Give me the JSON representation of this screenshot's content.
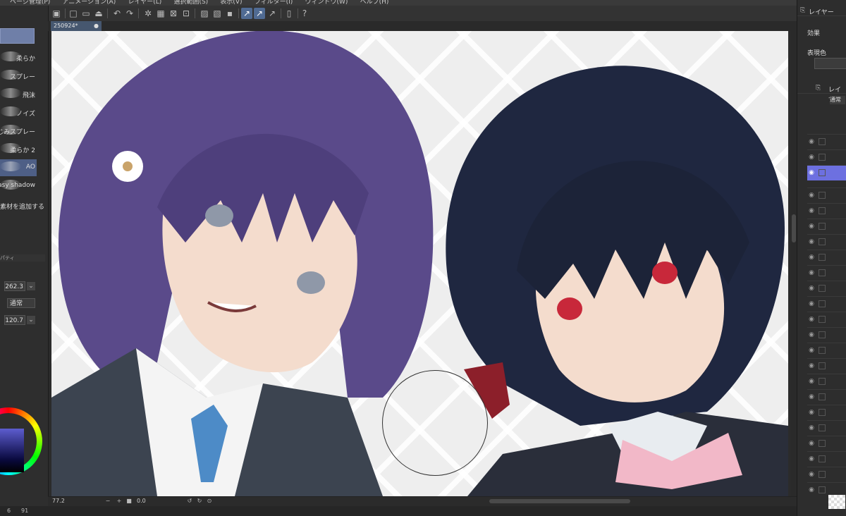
{
  "menubar": {
    "items": [
      "ページ管理(P)",
      "アニメーション(A)",
      "レイヤー(L)",
      "選択範囲(S)",
      "表示(V)",
      "フィルター(I)",
      "ウィンドウ(W)",
      "ヘルプ(H)"
    ]
  },
  "toolbar": {
    "icons": [
      "app-icon",
      "new-file-icon",
      "open-icon",
      "save-icon",
      "print-icon",
      "undo-icon",
      "redo-icon",
      "clear-icon",
      "fill-icon",
      "deselect-icon",
      "transform-icon",
      "show-selection-icon",
      "ruler-icon",
      "snap-icon",
      "snap-active-icon",
      "snap-ruler-icon",
      "device-icon",
      "help-icon"
    ]
  },
  "canvas_tab": {
    "label": "250924*",
    "close": "●"
  },
  "brushes": [
    {
      "label": "柔らか"
    },
    {
      "label": "スプレー"
    },
    {
      "label": "飛沫"
    },
    {
      "label": "ノイズ"
    },
    {
      "label": "にじみスプレー"
    },
    {
      "label": "柔らか 2"
    },
    {
      "label": "AO"
    },
    {
      "label": "easy shadow"
    }
  ],
  "brush_footer": {
    "add_material": "素材を追加する"
  },
  "properties": {
    "header": "パティ",
    "size": "262.3",
    "blend": "通常",
    "density": "120.7"
  },
  "color": {
    "foreground": "#3a3ab8"
  },
  "status": {
    "zoom": "77.2",
    "angle": "0.0"
  },
  "bottom": {
    "left_num": "6",
    "right_num": "91"
  },
  "right_panel": {
    "effect_title": "レイヤー",
    "effect_label": "効果",
    "color_label": "表現色",
    "layer_title": "レイヤー",
    "blend_mode": "通常"
  }
}
